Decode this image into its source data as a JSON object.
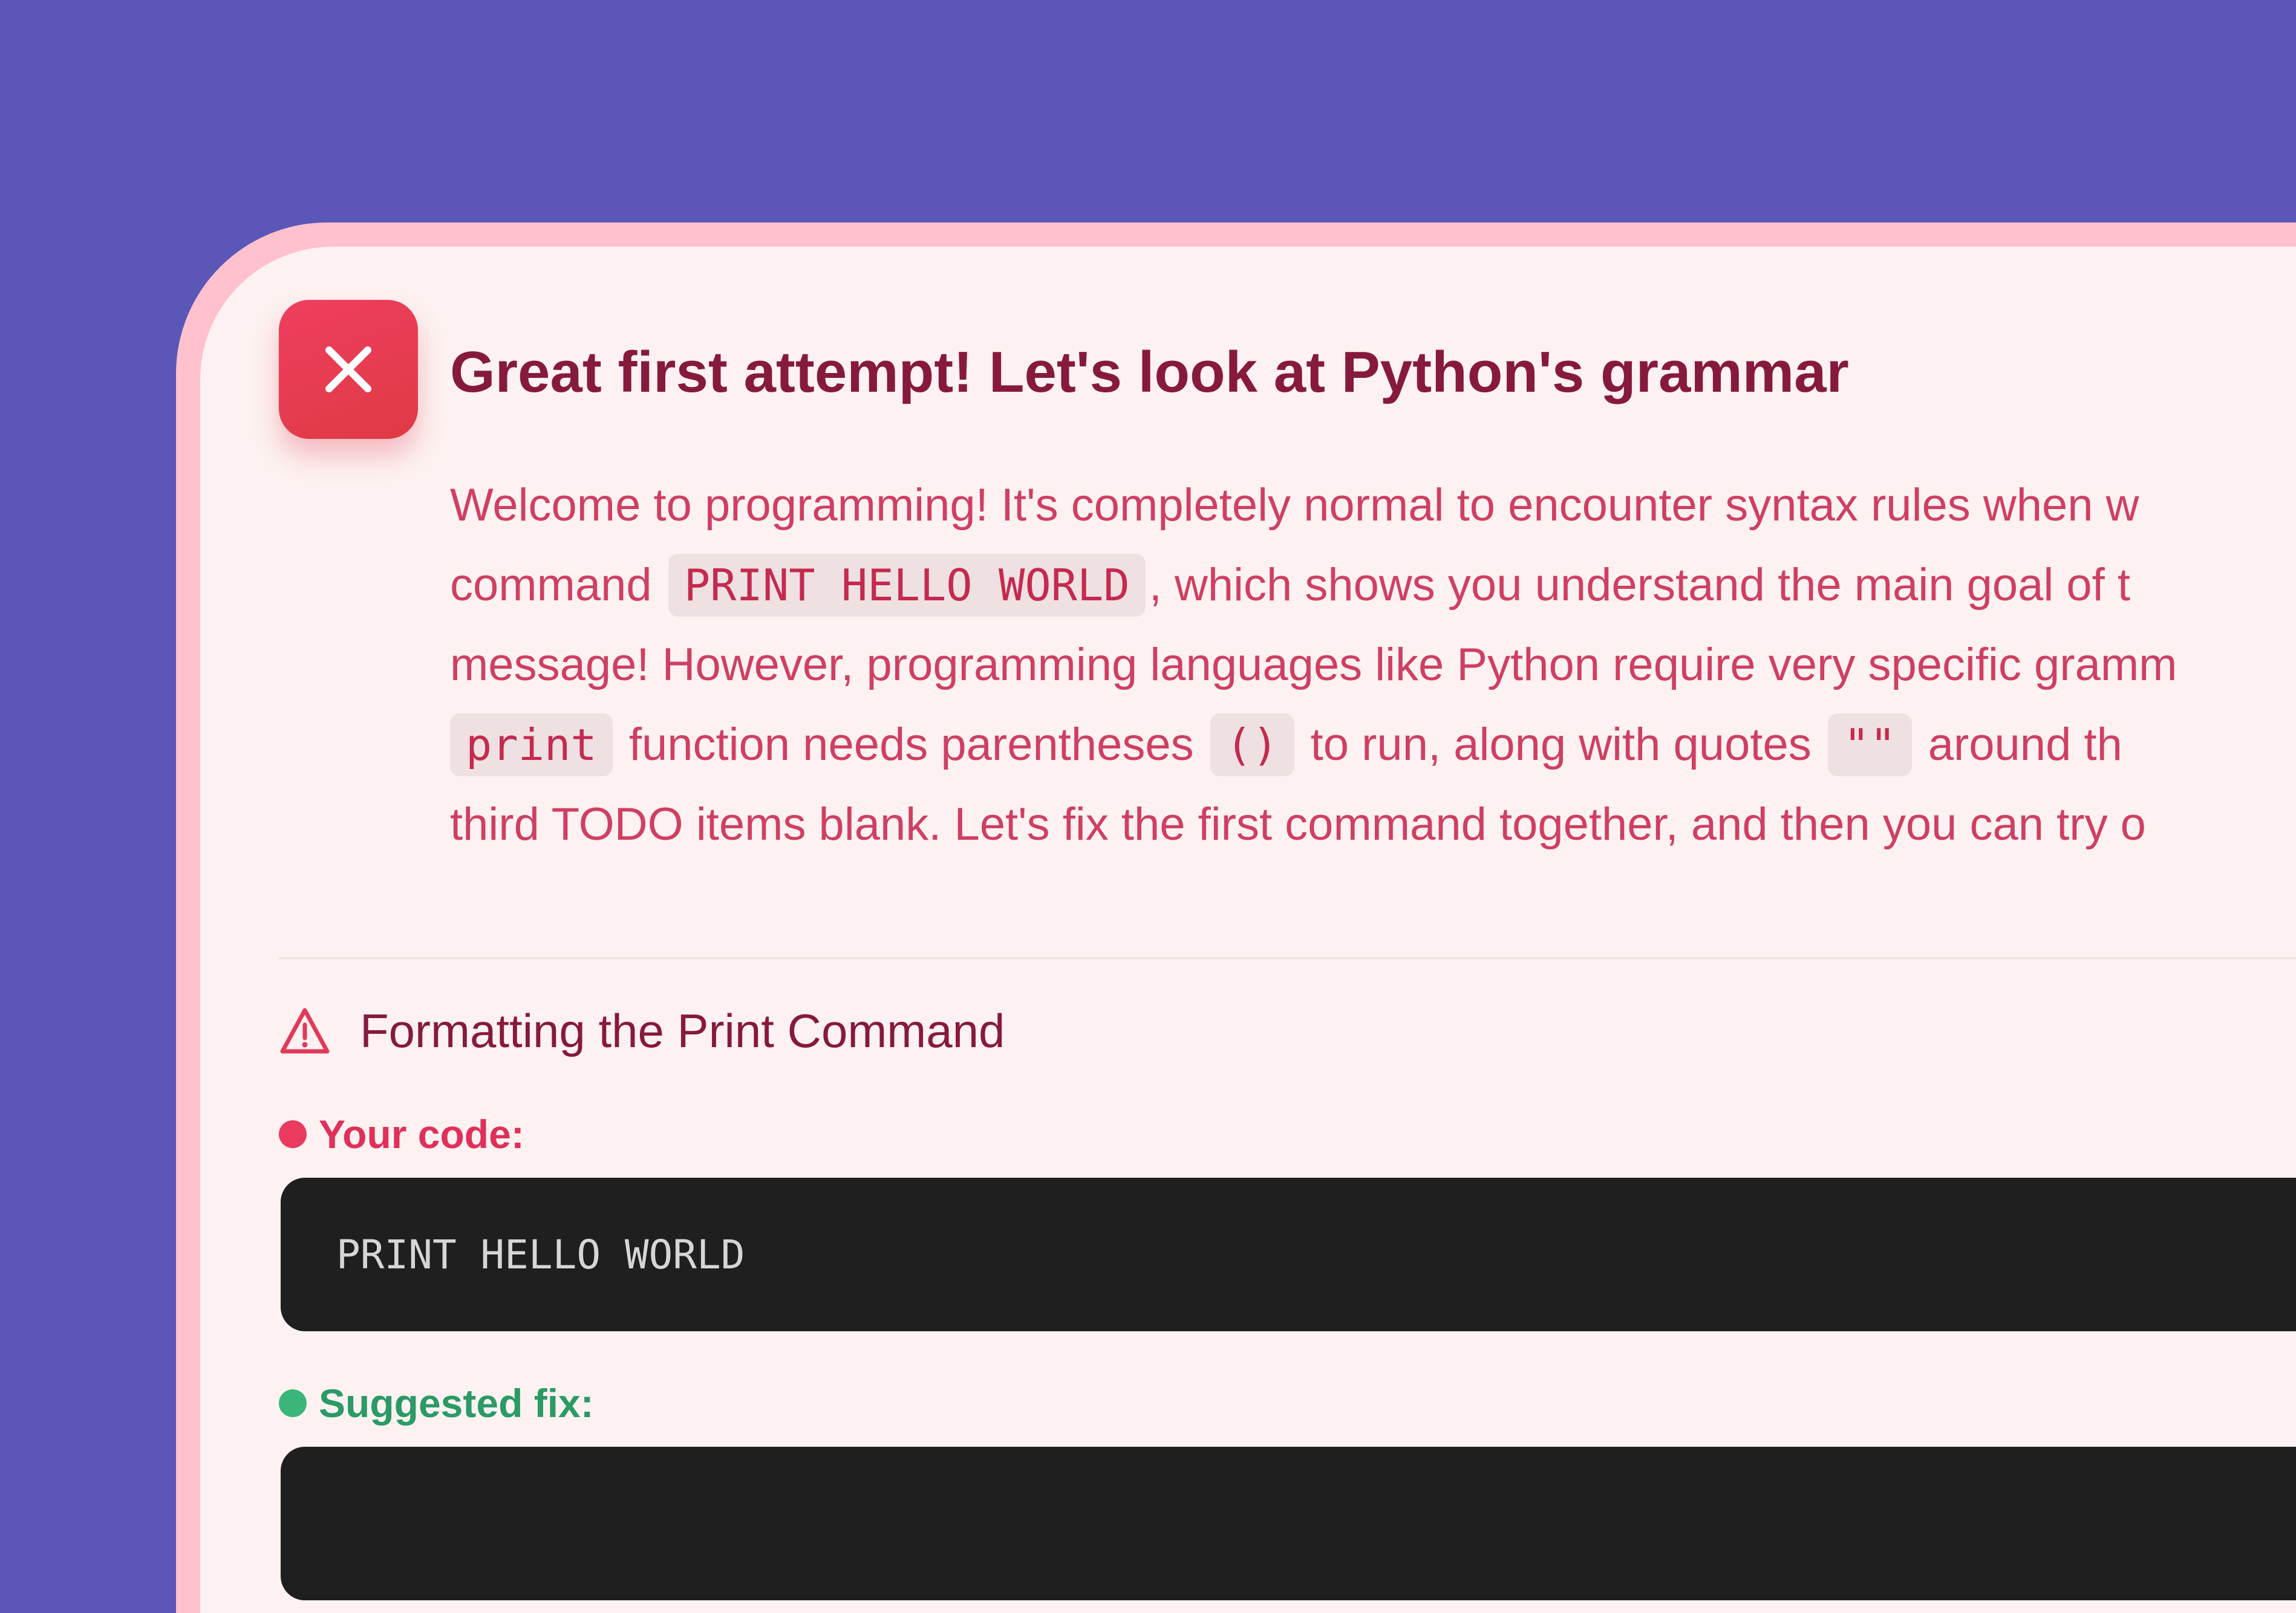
{
  "header": {
    "title": "Great first attempt! Let's look at Python's grammar",
    "status_icon": "close-icon"
  },
  "intro": {
    "line1": "Welcome to programming! It's completely normal to encounter syntax rules when w",
    "line2_before": "command",
    "line2_code": "PRINT HELLO WORLD",
    "line2_after": ", which shows you understand the main goal of t",
    "line3": "message! However, programming languages like Python require very specific gramm",
    "line4_code1": "print",
    "line4_text1": "function needs parentheses",
    "line4_code2": "()",
    "line4_text2": "to run, along with quotes",
    "line4_code3": "\"\"",
    "line4_text3": "around th",
    "line5": "third TODO items blank. Let's fix the first command together, and then you can try o"
  },
  "section": {
    "icon": "warning-icon",
    "title": "Formatting the Print Command"
  },
  "your_code": {
    "label": "Your code:",
    "code": "PRINT HELLO WORLD"
  },
  "suggested_fix": {
    "label": "Suggested fix:",
    "code": ""
  },
  "colors": {
    "background": "#5b57b8",
    "card_border": "#ffc1cd",
    "card_bg": "#fdf2f1",
    "accent_red": "#e03a45",
    "title_text": "#861a3c",
    "body_text": "#cf3f63",
    "success_green": "#3bb67a",
    "code_bg": "#1f1f1f"
  }
}
